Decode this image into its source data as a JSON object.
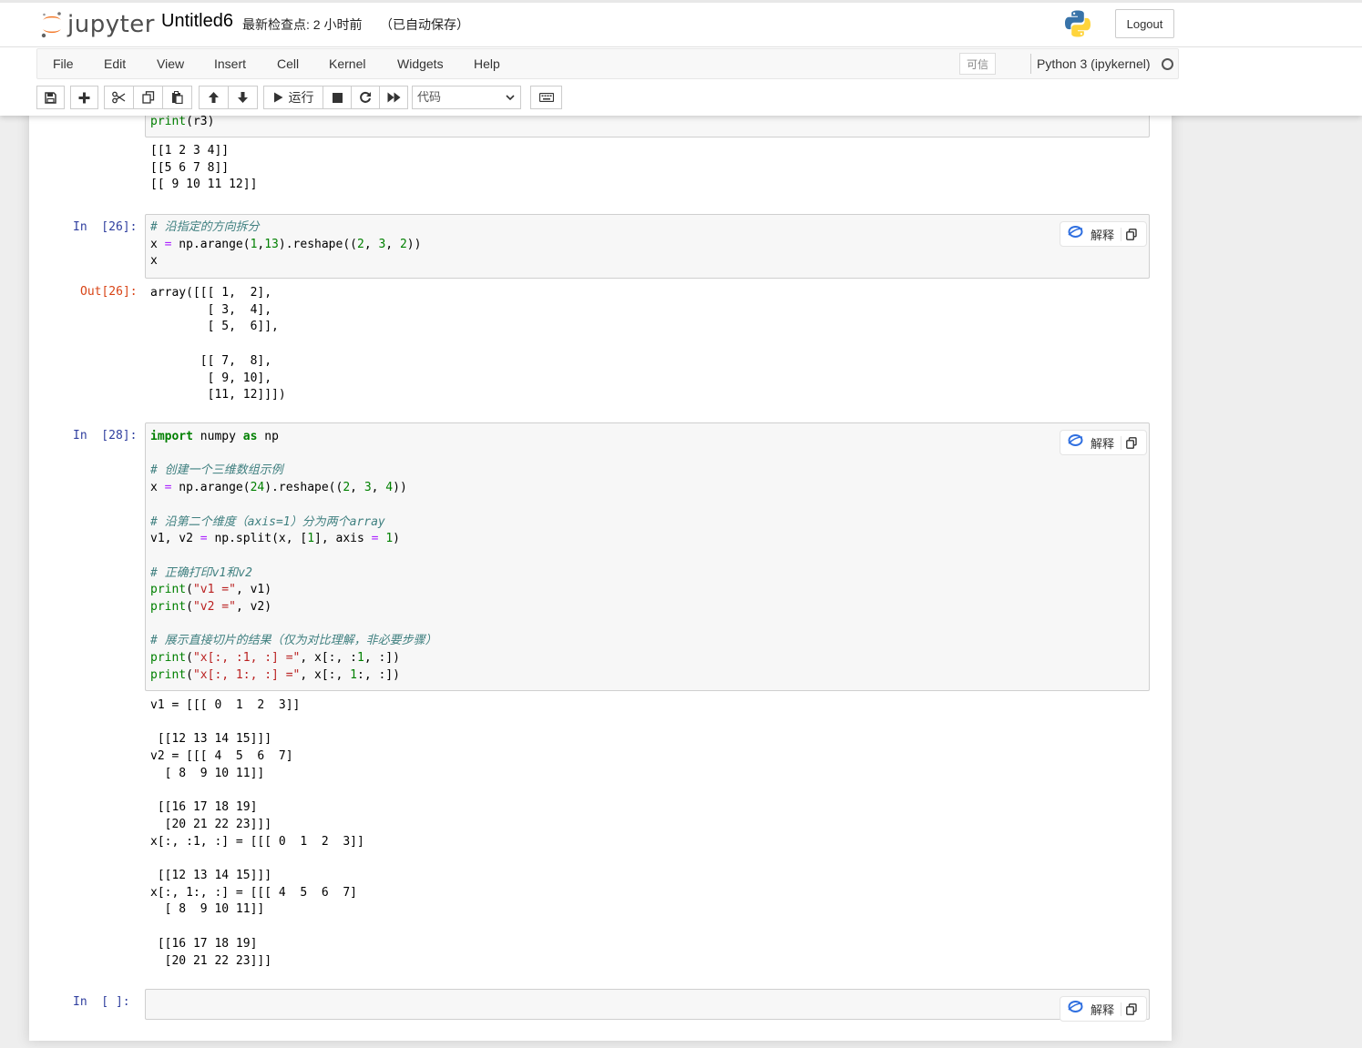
{
  "header": {
    "logo_text": "jupyter",
    "notebook_name": "Untitled6",
    "checkpoint": "最新检查点: 2 小时前",
    "autosave": "（已自动保存）",
    "logout_label": "Logout"
  },
  "menubar": {
    "items": [
      "File",
      "Edit",
      "View",
      "Insert",
      "Cell",
      "Kernel",
      "Widgets",
      "Help"
    ],
    "trusted_label": "可信",
    "kernel_name": "Python 3 (ipykernel)"
  },
  "toolbar": {
    "run_label": "运行",
    "cell_type": "代码"
  },
  "cells": {
    "c0": {
      "source_last_line": "print(r3)",
      "output": "[[1 2 3 4]]\n[[5 6 7 8]]\n[[ 9 10 11 12]]"
    },
    "c26": {
      "prompt_in": "In  [26]:",
      "prompt_out": "Out[26]:",
      "source": [
        "# 沿指定的方向拆分",
        "x = np.arange(1,13).reshape((2, 3, 2))",
        "x"
      ],
      "output": "array([[[ 1,  2],\n        [ 3,  4],\n        [ 5,  6]],\n\n       [[ 7,  8],\n        [ 9, 10],\n        [11, 12]]])"
    },
    "c28": {
      "prompt_in": "In  [28]:",
      "source": [
        "import numpy as np",
        "",
        "# 创建一个三维数组示例",
        "x = np.arange(24).reshape((2, 3, 4))",
        "",
        "# 沿第二个维度（axis=1）分为两个array",
        "v1, v2 = np.split(x, [1], axis = 1)",
        "",
        "# 正确打印v1和v2",
        "print(\"v1 =\", v1)",
        "print(\"v2 =\", v2)",
        "",
        "# 展示直接切片的结果（仅为对比理解，非必要步骤）",
        "print(\"x[:, :1, :] =\", x[:, :1, :])",
        "print(\"x[:, 1:, :] =\", x[:, 1:, :])"
      ],
      "output": "v1 = [[[ 0  1  2  3]]\n\n [[12 13 14 15]]]\nv2 = [[[ 4  5  6  7]\n  [ 8  9 10 11]]\n\n [[16 17 18 19]\n  [20 21 22 23]]]\nx[:, :1, :] = [[[ 0  1  2  3]]\n\n [[12 13 14 15]]]\nx[:, 1:, :] = [[[ 4  5  6  7]\n  [ 8  9 10 11]]\n\n [[16 17 18 19]\n  [20 21 22 23]]]"
    },
    "cempty": {
      "prompt_in": "In  [ ]:"
    }
  },
  "explain_label": "解释"
}
